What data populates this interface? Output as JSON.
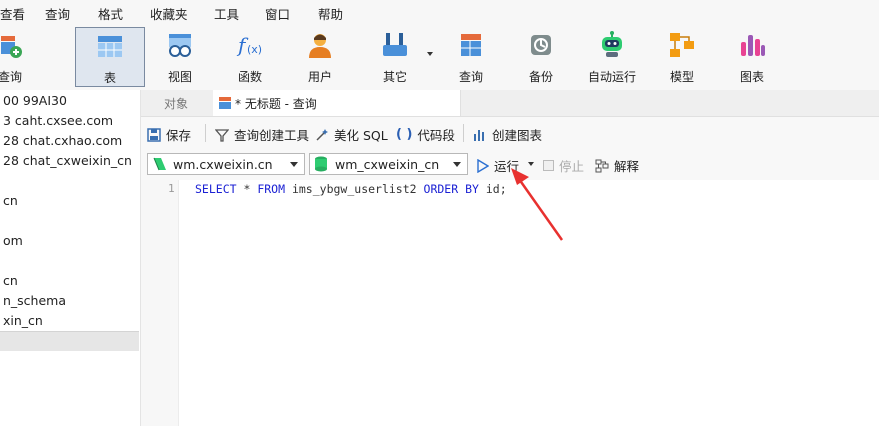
{
  "menu": {
    "items": [
      "查看",
      "查询",
      "格式",
      "收藏夹",
      "工具",
      "窗口",
      "帮助"
    ]
  },
  "toolbar": {
    "items": [
      {
        "label": "查询",
        "icon": "new-query-icon"
      },
      {
        "label": "表",
        "icon": "table-icon",
        "active": true
      },
      {
        "label": "视图",
        "icon": "view-icon"
      },
      {
        "label": "函数",
        "icon": "function-icon"
      },
      {
        "label": "用户",
        "icon": "user-icon"
      },
      {
        "label": "其它",
        "icon": "tools-icon"
      },
      {
        "label": "查询",
        "icon": "query-icon"
      },
      {
        "label": "备份",
        "icon": "backup-icon"
      },
      {
        "label": "自动运行",
        "icon": "robot-icon"
      },
      {
        "label": "模型",
        "icon": "model-icon"
      },
      {
        "label": "图表",
        "icon": "chart-icon"
      }
    ]
  },
  "sidebar": {
    "connections": [
      "00 99AI30",
      "3 caht.cxsee.com",
      "28 chat.cxhao.com",
      "28 chat_cxweixin_cn",
      "cn",
      "om",
      "cn",
      "n_schema",
      "xin_cn"
    ]
  },
  "tabs": {
    "objects_label": "对象",
    "query_label": "* 无标题 - 查询"
  },
  "query_toolbar": {
    "save": "保存",
    "builder": "查询创建工具",
    "beautify": "美化 SQL",
    "snippet": "代码段",
    "create_chart": "创建图表"
  },
  "db_row": {
    "connection": "wm.cxweixin.cn",
    "database": "wm_cxweixin_cn",
    "run": "运行",
    "stop": "停止",
    "explain": "解释"
  },
  "editor": {
    "line_number": "1",
    "sql": {
      "select": "SELECT",
      "star": " * ",
      "from": "FROM",
      "table": " ims_ybgw_userlist2 ",
      "order": "ORDER",
      "by": "BY",
      "rest": " id;"
    }
  },
  "colors": {
    "keyword": "#1c22d4",
    "annotation_arrow": "#e8312f"
  }
}
